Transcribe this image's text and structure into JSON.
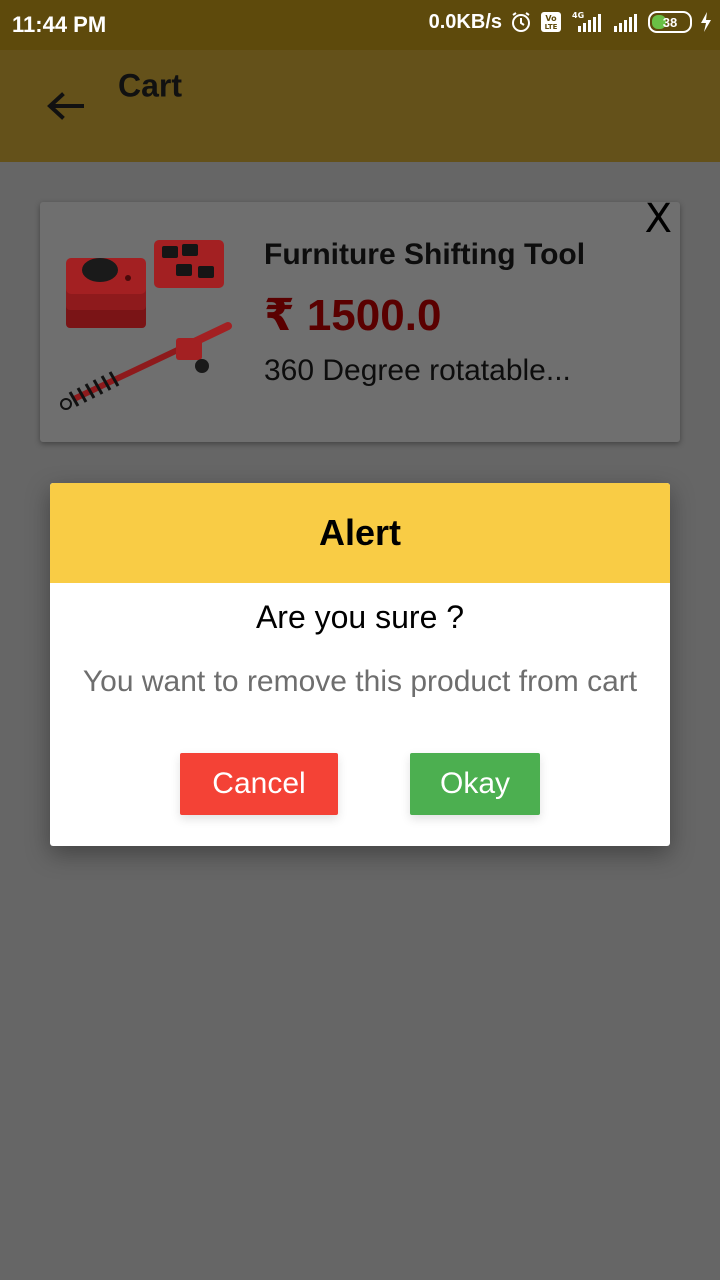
{
  "status_bar": {
    "time": "11:44 PM",
    "net_speed": "0.0KB/s",
    "battery_level": "38",
    "battery_fraction": 0.38,
    "icons": [
      "alarm-icon",
      "volte-icon",
      "signal-4g-icon",
      "signal-icon",
      "battery-icon",
      "charging-icon"
    ]
  },
  "app_bar": {
    "title": "Cart",
    "back_icon": "arrow-left-icon"
  },
  "cart_item": {
    "name": "Furniture Shifting Tool",
    "price": "₹ 1500.0",
    "description": "360 Degree rotatable...",
    "remove_label": "X"
  },
  "dialog": {
    "title": "Alert",
    "question": "Are you sure ?",
    "message": "You want to remove this product from cart",
    "cancel_label": "Cancel",
    "okay_label": "Okay"
  },
  "colors": {
    "status_bar": "#5e4a0c",
    "app_bar": "#64511a",
    "dialog_header": "#f9cc45",
    "cancel": "#f44236",
    "okay": "#4caf50",
    "price": "#5a0000"
  }
}
